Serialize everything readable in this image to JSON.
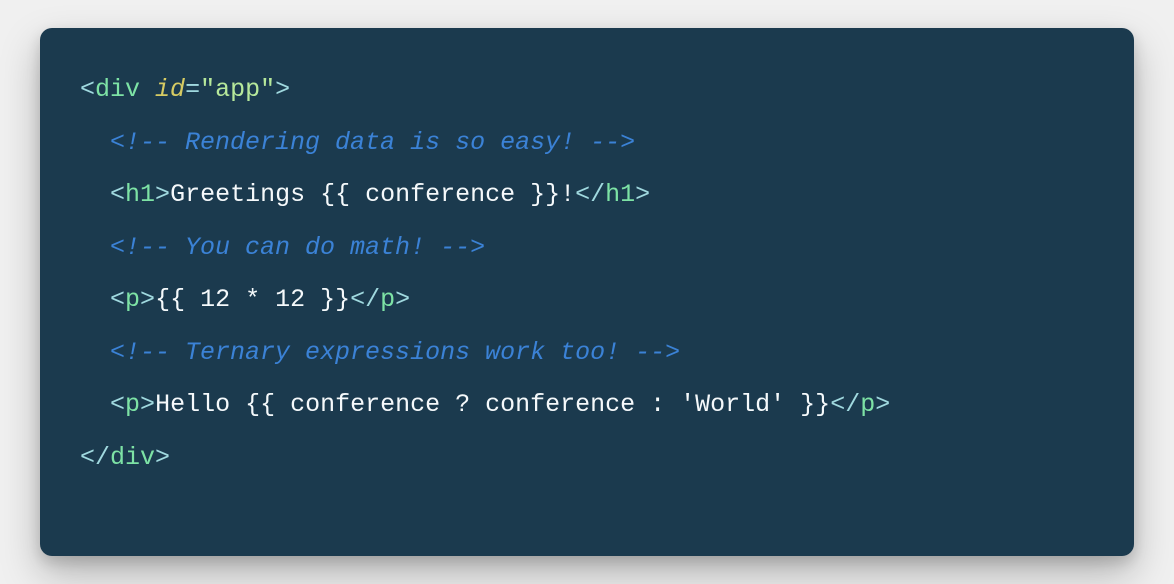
{
  "colors": {
    "background": "#1b3a4e",
    "bracket": "#a0d9df",
    "tag": "#7de2a5",
    "attr": "#d6cb63",
    "string": "#b6e89b",
    "comment": "#3b82d6",
    "text": "#f5f9fb"
  },
  "code_lines": [
    [
      {
        "type": "bracket",
        "text": "<"
      },
      {
        "type": "tag",
        "text": "div"
      },
      {
        "type": "text",
        "text": " "
      },
      {
        "type": "attr",
        "text": "id"
      },
      {
        "type": "bracket",
        "text": "="
      },
      {
        "type": "string",
        "text": "\"app\""
      },
      {
        "type": "bracket",
        "text": ">"
      }
    ],
    [
      {
        "type": "indent",
        "text": "  "
      },
      {
        "type": "comment",
        "text": "<!-- Rendering data is so easy! -->"
      }
    ],
    [
      {
        "type": "indent",
        "text": "  "
      },
      {
        "type": "bracket",
        "text": "<"
      },
      {
        "type": "tag",
        "text": "h1"
      },
      {
        "type": "bracket",
        "text": ">"
      },
      {
        "type": "text",
        "text": "Greetings {{ conference }}!"
      },
      {
        "type": "bracket",
        "text": "</"
      },
      {
        "type": "tag",
        "text": "h1"
      },
      {
        "type": "bracket",
        "text": ">"
      }
    ],
    [
      {
        "type": "indent",
        "text": "  "
      },
      {
        "type": "comment",
        "text": "<!-- You can do math! -->"
      }
    ],
    [
      {
        "type": "indent",
        "text": "  "
      },
      {
        "type": "bracket",
        "text": "<"
      },
      {
        "type": "tag",
        "text": "p"
      },
      {
        "type": "bracket",
        "text": ">"
      },
      {
        "type": "text",
        "text": "{{ 12 * 12 }}"
      },
      {
        "type": "bracket",
        "text": "</"
      },
      {
        "type": "tag",
        "text": "p"
      },
      {
        "type": "bracket",
        "text": ">"
      }
    ],
    [
      {
        "type": "indent",
        "text": "  "
      },
      {
        "type": "comment",
        "text": "<!-- Ternary expressions work too! -->"
      }
    ],
    [
      {
        "type": "indent",
        "text": "  "
      },
      {
        "type": "bracket",
        "text": "<"
      },
      {
        "type": "tag",
        "text": "p"
      },
      {
        "type": "bracket",
        "text": ">"
      },
      {
        "type": "text",
        "text": "Hello {{ conference ? conference : 'World' }}"
      },
      {
        "type": "bracket",
        "text": "</"
      },
      {
        "type": "tag",
        "text": "p"
      },
      {
        "type": "bracket",
        "text": ">"
      }
    ],
    [
      {
        "type": "bracket",
        "text": "</"
      },
      {
        "type": "tag",
        "text": "div"
      },
      {
        "type": "bracket",
        "text": ">"
      }
    ]
  ]
}
